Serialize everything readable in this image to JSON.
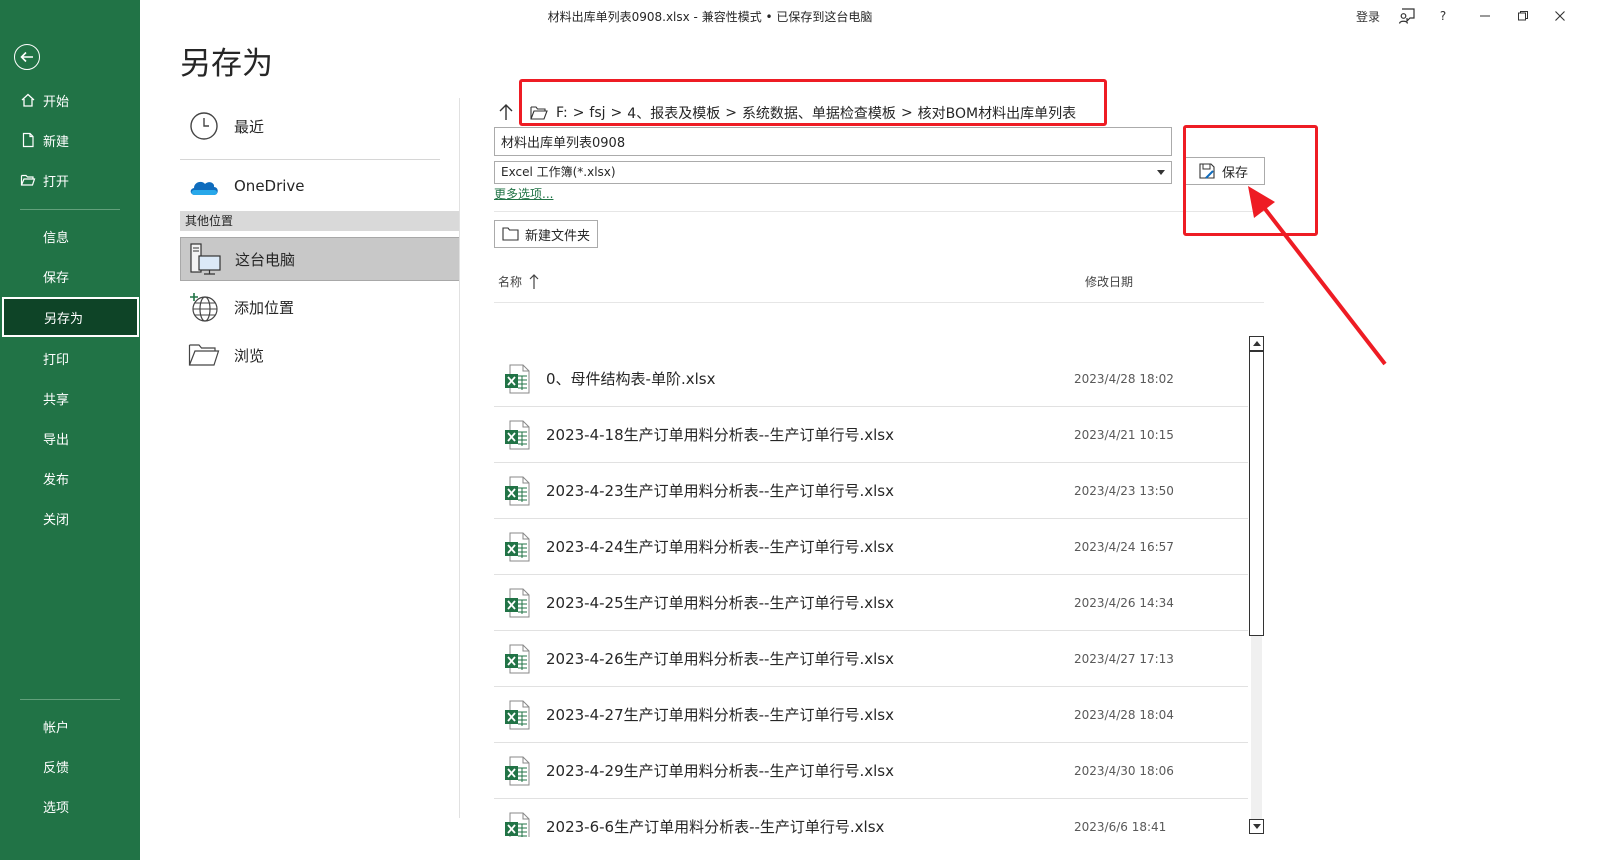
{
  "window": {
    "title": "材料出库单列表0908.xlsx  -  兼容性模式 • 已保存到这台电脑",
    "signin": "登录",
    "help": "?",
    "accent": "#217346"
  },
  "nav": {
    "items": [
      {
        "label": "开始",
        "icon": "home-icon"
      },
      {
        "label": "新建",
        "icon": "new-document-icon"
      },
      {
        "label": "打开",
        "icon": "folder-open-icon"
      },
      {
        "label": "信息"
      },
      {
        "label": "保存"
      },
      {
        "label": "另存为",
        "active": true
      },
      {
        "label": "打印"
      },
      {
        "label": "共享"
      },
      {
        "label": "导出"
      },
      {
        "label": "发布"
      },
      {
        "label": "关闭"
      },
      {
        "label": "帐户"
      },
      {
        "label": "反馈"
      },
      {
        "label": "选项"
      }
    ]
  },
  "page": {
    "title": "另存为"
  },
  "locations": {
    "recent": "最近",
    "onedrive": "OneDrive",
    "other_header": "其他位置",
    "this_pc": "这台电脑",
    "add_place": "添加位置",
    "browse": "浏览"
  },
  "path": [
    "F:",
    "fsj",
    "4、报表及模板",
    "系统数据、单据检查模板",
    "核对BOM材料出库单列表"
  ],
  "save": {
    "filename": "材料出库单列表0908",
    "filetype": "Excel 工作簿(*.xlsx)",
    "more_options": "更多选项...",
    "save_label": "保存",
    "new_folder": "新建文件夹"
  },
  "columns": {
    "name": "名称",
    "date": "修改日期"
  },
  "files": [
    {
      "name": "0、母件结构表-单阶.xlsx",
      "date": "2023/4/28 18:02"
    },
    {
      "name": "2023-4-18生产订单用料分析表--生产订单行号.xlsx",
      "date": "2023/4/21 10:15"
    },
    {
      "name": "2023-4-23生产订单用料分析表--生产订单行号.xlsx",
      "date": "2023/4/23 13:50"
    },
    {
      "name": "2023-4-24生产订单用料分析表--生产订单行号.xlsx",
      "date": "2023/4/24 16:57"
    },
    {
      "name": "2023-4-25生产订单用料分析表--生产订单行号.xlsx",
      "date": "2023/4/26 14:34"
    },
    {
      "name": "2023-4-26生产订单用料分析表--生产订单行号.xlsx",
      "date": "2023/4/27 17:13"
    },
    {
      "name": "2023-4-27生产订单用料分析表--生产订单行号.xlsx",
      "date": "2023/4/28 18:04"
    },
    {
      "name": "2023-4-29生产订单用料分析表--生产订单行号.xlsx",
      "date": "2023/4/30 18:06"
    },
    {
      "name": "2023-6-6生产订单用料分析表--生产订单行号.xlsx",
      "date": "2023/6/6 18:41"
    }
  ],
  "annotation": {
    "color": "#ee1c24"
  }
}
